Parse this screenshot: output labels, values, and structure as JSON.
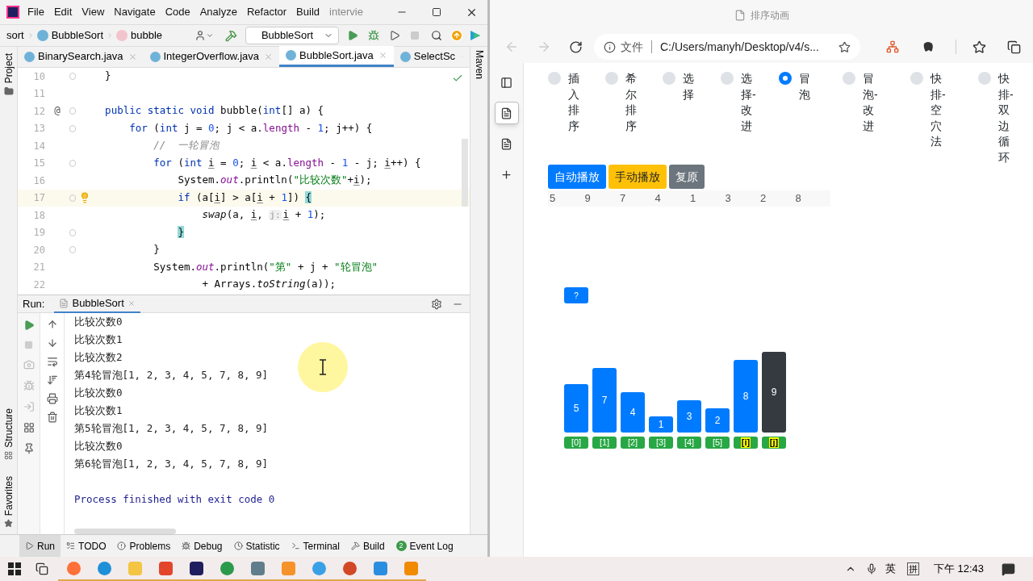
{
  "ide": {
    "menu": [
      "File",
      "Edit",
      "View",
      "Navigate",
      "Code",
      "Analyze",
      "Refactor",
      "Build"
    ],
    "title": "intervie",
    "breadcrumb": [
      "sort",
      "BubbleSort",
      "bubble"
    ],
    "run_config": "BubbleSort",
    "project_label": "Project",
    "structure_label": "Structure",
    "favorites_label": "Favorites",
    "maven_label": "Maven",
    "tabs": [
      {
        "label": "BinarySearch.java",
        "selected": false,
        "closable": true
      },
      {
        "label": "IntegerOverflow.java",
        "selected": false,
        "closable": true
      },
      {
        "label": "BubbleSort.java",
        "selected": true,
        "closable": true
      },
      {
        "label": "SelectSc",
        "selected": false,
        "closable": false
      }
    ],
    "code": [
      {
        "number": "10",
        "fold": true,
        "current": false,
        "intention": false,
        "tokens": [
          {
            "kind": "p",
            "text": "    }"
          }
        ]
      },
      {
        "number": "11",
        "fold": false,
        "current": false,
        "intention": false
      },
      {
        "number": "12",
        "fold": true,
        "current": false,
        "intention": false,
        "gutter_mark": "@",
        "tokens": [
          {
            "kind": "kw",
            "text": "    public static void"
          },
          {
            "kind": "p",
            "text": " bubble("
          },
          {
            "kind": "kw",
            "text": "int"
          },
          {
            "kind": "p",
            "text": "[] a) {"
          }
        ]
      },
      {
        "number": "13",
        "fold": true,
        "current": false,
        "intention": false,
        "tokens": [
          {
            "kind": "kw",
            "text": "        for"
          },
          {
            "kind": "p",
            "text": " ("
          },
          {
            "kind": "kw",
            "text": "int"
          },
          {
            "kind": "p",
            "text": " j = "
          },
          {
            "kind": "num",
            "text": "0"
          },
          {
            "kind": "p",
            "text": "; j < a."
          },
          {
            "kind": "fld",
            "text": "length"
          },
          {
            "kind": "p",
            "text": " - "
          },
          {
            "kind": "num",
            "text": "1"
          },
          {
            "kind": "p",
            "text": "; j++) {"
          }
        ]
      },
      {
        "number": "14",
        "fold": false,
        "current": false,
        "intention": false,
        "tokens": [
          {
            "kind": "cm",
            "text": "            //  一轮冒泡"
          }
        ]
      },
      {
        "number": "15",
        "fold": true,
        "current": false,
        "intention": false,
        "tokens": [
          {
            "kind": "kw",
            "text": "            for"
          },
          {
            "kind": "p",
            "text": " ("
          },
          {
            "kind": "kw",
            "text": "int "
          },
          {
            "kind": "var",
            "text": "i"
          },
          {
            "kind": "p",
            "text": " = "
          },
          {
            "kind": "num",
            "text": "0"
          },
          {
            "kind": "p",
            "text": "; "
          },
          {
            "kind": "var",
            "text": "i"
          },
          {
            "kind": "p",
            "text": " < a."
          },
          {
            "kind": "fld",
            "text": "length"
          },
          {
            "kind": "p",
            "text": " - "
          },
          {
            "kind": "num",
            "text": "1"
          },
          {
            "kind": "p",
            "text": " - j; "
          },
          {
            "kind": "var",
            "text": "i"
          },
          {
            "kind": "p",
            "text": "++) {"
          }
        ]
      },
      {
        "number": "16",
        "fold": false,
        "current": false,
        "intention": false,
        "tokens": [
          {
            "kind": "p",
            "text": "                System."
          },
          {
            "kind": "sfld",
            "text": "out"
          },
          {
            "kind": "p",
            "text": ".println("
          },
          {
            "kind": "str",
            "text": "\"比较次数\""
          },
          {
            "kind": "p",
            "text": "+"
          },
          {
            "kind": "var",
            "text": "i"
          },
          {
            "kind": "p",
            "text": ");"
          }
        ]
      },
      {
        "number": "17",
        "fold": true,
        "current": true,
        "intention": true,
        "tokens": [
          {
            "kind": "kw",
            "text": "                if"
          },
          {
            "kind": "p",
            "text": " (a["
          },
          {
            "kind": "var",
            "text": "i"
          },
          {
            "kind": "p",
            "text": "] > a["
          },
          {
            "kind": "var",
            "text": "i"
          },
          {
            "kind": "p",
            "text": " + "
          },
          {
            "kind": "num",
            "text": "1"
          },
          {
            "kind": "p",
            "text": "]) "
          },
          {
            "kind": "brace",
            "text": "{"
          }
        ]
      },
      {
        "number": "18",
        "fold": false,
        "current": false,
        "intention": false,
        "tokens": [
          {
            "kind": "it",
            "text": "                    swap"
          },
          {
            "kind": "p",
            "text": "(a, "
          },
          {
            "kind": "var",
            "text": "i"
          },
          {
            "kind": "p",
            "text": ", "
          },
          {
            "kind": "hint",
            "text": "j:"
          },
          {
            "kind": "var",
            "text": "i"
          },
          {
            "kind": "p",
            "text": " + "
          },
          {
            "kind": "num",
            "text": "1"
          },
          {
            "kind": "p",
            "text": ");"
          }
        ]
      },
      {
        "number": "19",
        "fold": true,
        "current": false,
        "intention": false,
        "tokens": [
          {
            "kind": "brace",
            "text": "                }"
          }
        ]
      },
      {
        "number": "20",
        "fold": true,
        "current": false,
        "intention": false,
        "tokens": [
          {
            "kind": "p",
            "text": "            }"
          }
        ]
      },
      {
        "number": "21",
        "fold": false,
        "current": false,
        "intention": false,
        "tokens": [
          {
            "kind": "p",
            "text": "            System."
          },
          {
            "kind": "sfld",
            "text": "out"
          },
          {
            "kind": "p",
            "text": ".println("
          },
          {
            "kind": "str",
            "text": "\"第\""
          },
          {
            "kind": "p",
            "text": " + j + "
          },
          {
            "kind": "str",
            "text": "\"轮冒泡\""
          }
        ]
      },
      {
        "number": "22",
        "fold": false,
        "current": false,
        "intention": false,
        "tokens": [
          {
            "kind": "p",
            "text": "                    + Arrays."
          },
          {
            "kind": "it",
            "text": "toString"
          },
          {
            "kind": "p",
            "text": "(a));"
          }
        ]
      }
    ],
    "run": {
      "label": "Run:",
      "tab": "BubbleSort",
      "tab_selected": true,
      "output": [
        "比较次数0",
        "比较次数1",
        "比较次数2",
        "第4轮冒泡[1, 2, 3, 4, 5, 7, 8, 9]",
        "比较次数0",
        "比较次数1",
        "第5轮冒泡[1, 2, 3, 4, 5, 7, 8, 9]",
        "比较次数0",
        "第6轮冒泡[1, 2, 3, 4, 5, 7, 8, 9]"
      ],
      "exit": "Process finished with exit code 0"
    },
    "tool_windows": [
      {
        "label": "Run",
        "selected": true,
        "kind": "run"
      },
      {
        "label": "TODO",
        "selected": false,
        "kind": "todo"
      },
      {
        "label": "Problems",
        "selected": false,
        "kind": "problems"
      },
      {
        "label": "Debug",
        "selected": false,
        "kind": "debug"
      },
      {
        "label": "Statistic",
        "selected": false,
        "kind": "statistic"
      },
      {
        "label": "Terminal",
        "selected": false,
        "kind": "terminal"
      },
      {
        "label": "Build",
        "selected": false,
        "kind": "build"
      },
      {
        "label": "Event Log",
        "selected": false,
        "kind": "log",
        "badge": "2"
      }
    ]
  },
  "browser": {
    "title": "排序动画",
    "info": "文件",
    "url": "C:/Users/manyh/Desktop/v4/s...",
    "vertical_tabs": [
      {
        "selected": false,
        "kind": "tabs"
      },
      {
        "selected": true,
        "kind": "page"
      },
      {
        "selected": false,
        "kind": "page"
      },
      {
        "selected": false,
        "kind": "add"
      }
    ],
    "page": {
      "options": [
        {
          "label": "插入排序",
          "selected": false
        },
        {
          "label": "希尔排序",
          "selected": false
        },
        {
          "label": "选择",
          "selected": false
        },
        {
          "label": "选择-改进",
          "selected": false
        },
        {
          "label": "冒泡",
          "selected": true
        },
        {
          "label": "冒泡-改进",
          "selected": false
        },
        {
          "label": "快排-空穴法",
          "selected": false
        },
        {
          "label": "快排-双边循环",
          "selected": false
        }
      ],
      "buttons": [
        {
          "label": "自动播放",
          "kind": "primary"
        },
        {
          "label": "手动播放",
          "kind": "warning"
        },
        {
          "label": "复原",
          "kind": "secondary"
        }
      ],
      "array": [
        "5",
        "9",
        "7",
        "4",
        "1",
        "3",
        "2",
        "8"
      ],
      "pointer": "?",
      "bars": [
        {
          "value": "5",
          "label": "[0]",
          "sorted": false,
          "highlighted": false
        },
        {
          "value": "7",
          "label": "[1]",
          "sorted": false,
          "highlighted": false
        },
        {
          "value": "4",
          "label": "[2]",
          "sorted": false,
          "highlighted": false
        },
        {
          "value": "1",
          "label": "[3]",
          "sorted": false,
          "highlighted": false
        },
        {
          "value": "3",
          "label": "[4]",
          "sorted": false,
          "highlighted": false
        },
        {
          "value": "2",
          "label": "[5]",
          "sorted": false,
          "highlighted": false
        },
        {
          "value": "8",
          "label": "[i]",
          "sorted": false,
          "highlighted": true
        },
        {
          "value": "9",
          "label": "[j]",
          "sorted": true,
          "highlighted": true
        }
      ]
    }
  },
  "taskbar": {
    "ime": "英",
    "ime_mode": "拼",
    "clock": "下午 12:43"
  }
}
